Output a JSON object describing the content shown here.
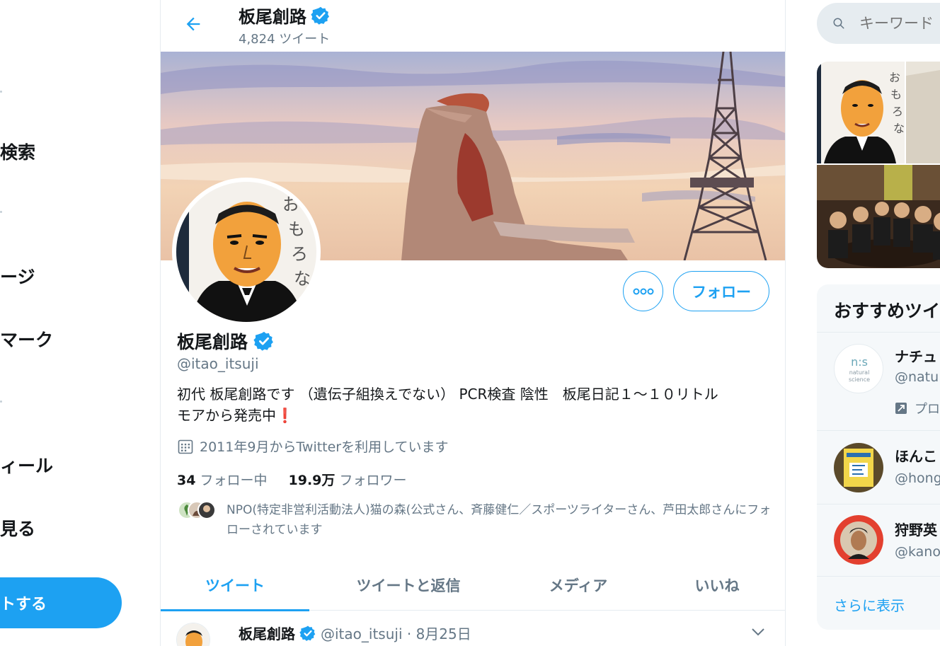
{
  "left_nav": {
    "items": [
      {
        "label": "検索"
      },
      {
        "label": "ージ"
      },
      {
        "label": "マーク"
      },
      {
        "label": "ィール"
      },
      {
        "label": "見る"
      }
    ],
    "tweet_button": "トする"
  },
  "header": {
    "name": "板尾創路",
    "tweet_count": "4,824 ツイート"
  },
  "profile": {
    "name": "板尾創路",
    "handle": "@itao_itsuji",
    "bio_line1": "初代 板尾創路です （遺伝子組換えでない） PCR検査 陰性　板尾日記１〜１０リトル",
    "bio_line2": "モアから発売中",
    "bio_emoji": "❗",
    "joined": "2011年9月からTwitterを利用しています",
    "following_count": "34",
    "following_label": "フォロー中",
    "followers_count": "19.9万",
    "followers_label": "フォロワー",
    "followed_by": "NPO(特定非営利活動法人)猫の森(公式さん、斉藤健仁／スポーツライターさん、芦田太郎さんにフォローされています",
    "avatar_caption": "おもろない"
  },
  "buttons": {
    "follow": "フォロー"
  },
  "tabs": [
    {
      "label": "ツイート",
      "active": true
    },
    {
      "label": "ツイートと返信",
      "active": false
    },
    {
      "label": "メディア",
      "active": false
    },
    {
      "label": "いいね",
      "active": false
    }
  ],
  "tweet": {
    "name": "板尾創路",
    "meta": "@itao_itsuji · 8月25日"
  },
  "search": {
    "placeholder": "キーワード"
  },
  "recommend": {
    "title": "おすすめツイ",
    "items": [
      {
        "name": "ナチュ",
        "handle": "@natu",
        "promo": "プロ",
        "logo_top": "n:s",
        "logo_bottom": "natural science"
      },
      {
        "name": "ほんこ",
        "handle": "@hong"
      },
      {
        "name": "狩野英",
        "handle": "@kano"
      }
    ],
    "show_more": "さらに表示"
  },
  "colors": {
    "accent": "#1da1f2",
    "text": "#14171a",
    "muted": "#657786",
    "border": "#e6ecf0"
  }
}
